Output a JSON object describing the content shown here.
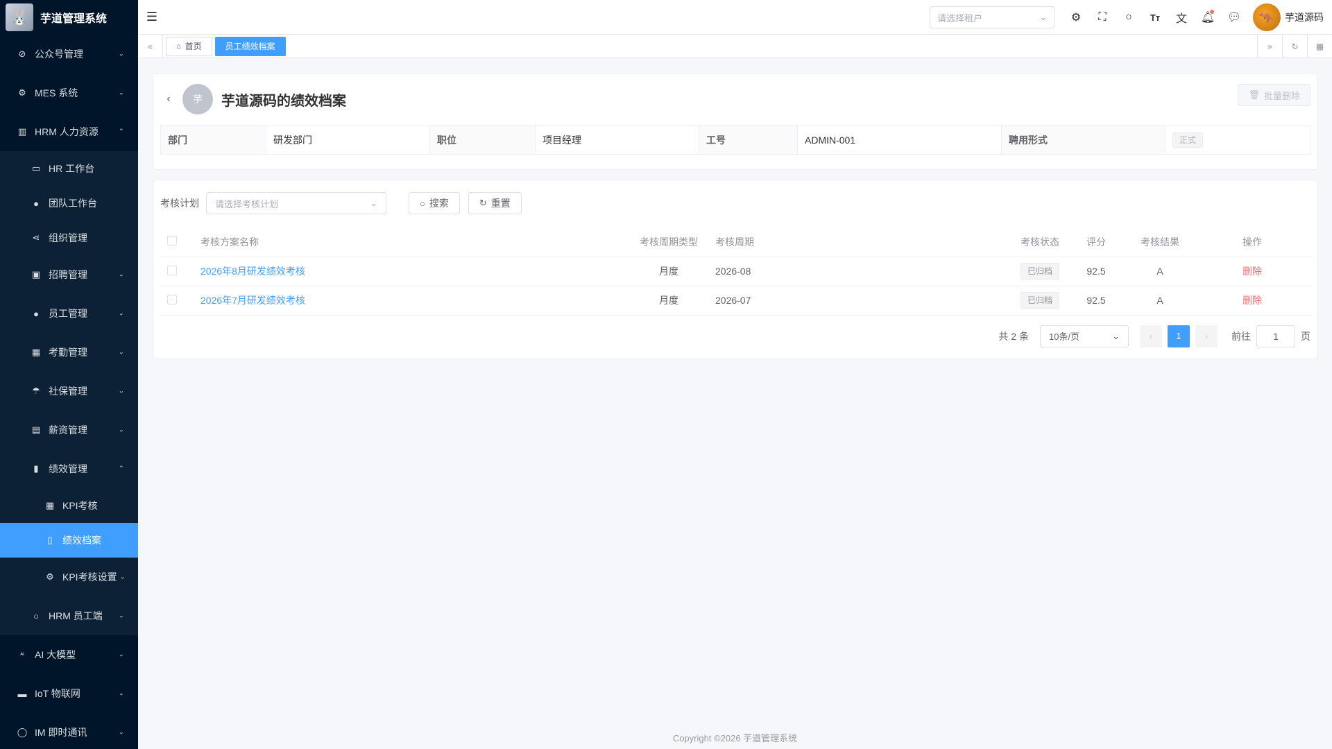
{
  "app": {
    "title": "芋道管理系统"
  },
  "sidebar": {
    "items": [
      {
        "label": "公众号管理",
        "icon": "compass-icon"
      },
      {
        "label": "MES 系统",
        "icon": "chip-icon"
      },
      {
        "label": "HRM 人力资源",
        "icon": "building-icon"
      },
      {
        "label": "HR 工作台",
        "icon": "monitor-icon"
      },
      {
        "label": "团队工作台",
        "icon": "user-icon"
      },
      {
        "label": "组织管理",
        "icon": "share-icon"
      },
      {
        "label": "招聘管理",
        "icon": "briefcase-icon"
      },
      {
        "label": "员工管理",
        "icon": "user-icon"
      },
      {
        "label": "考勤管理",
        "icon": "calendar-icon"
      },
      {
        "label": "社保管理",
        "icon": "umbrella-icon"
      },
      {
        "label": "薪资管理",
        "icon": "money-icon"
      },
      {
        "label": "绩效管理",
        "icon": "bar-chart-icon"
      },
      {
        "label": "KPI考核",
        "icon": "calendar-icon"
      },
      {
        "label": "绩效档案",
        "icon": "document-icon"
      },
      {
        "label": "KPI考核设置",
        "icon": "gear-icon"
      },
      {
        "label": "HRM 员工端",
        "icon": "user-icon"
      },
      {
        "label": "AI 大模型",
        "icon": "ai-icon"
      },
      {
        "label": "IoT 物联网",
        "icon": "car-icon"
      },
      {
        "label": "IM 即时通讯",
        "icon": "chat-icon"
      }
    ]
  },
  "header": {
    "tenant_placeholder": "请选择租户",
    "user_name": "芋道源码"
  },
  "tabs": [
    {
      "label": "首页"
    },
    {
      "label": "员工绩效档案"
    }
  ],
  "profile": {
    "avatar_text": "芋",
    "title": "芋道源码的绩效档案",
    "batch_delete_label": "批量删除",
    "fields": {
      "dept_label": "部门",
      "dept_value": "研发部门",
      "post_label": "职位",
      "post_value": "项目经理",
      "no_label": "工号",
      "no_value": "ADMIN-001",
      "type_label": "聘用形式",
      "type_value": "正式"
    }
  },
  "filter": {
    "plan_label": "考核计划",
    "plan_placeholder": "请选择考核计划",
    "search_label": "搜索",
    "reset_label": "重置"
  },
  "table": {
    "headers": {
      "name": "考核方案名称",
      "period_type": "考核周期类型",
      "period": "考核周期",
      "status": "考核状态",
      "score": "评分",
      "result": "考核结果",
      "action": "操作"
    },
    "rows": [
      {
        "name": "2026年8月研发绩效考核",
        "period_type": "月度",
        "period": "2026-08",
        "status": "已归档",
        "score": "92.5",
        "result": "A",
        "action": "删除"
      },
      {
        "name": "2026年7月研发绩效考核",
        "period_type": "月度",
        "period": "2026-07",
        "status": "已归档",
        "score": "92.5",
        "result": "A",
        "action": "删除"
      }
    ]
  },
  "pager": {
    "total_text": "共 2 条",
    "page_size": "10条/页",
    "current": "1",
    "goto_label": "前往",
    "goto_value": "1",
    "page_suffix": "页"
  },
  "footer": {
    "text": "Copyright ©2026 芋道管理系统"
  }
}
